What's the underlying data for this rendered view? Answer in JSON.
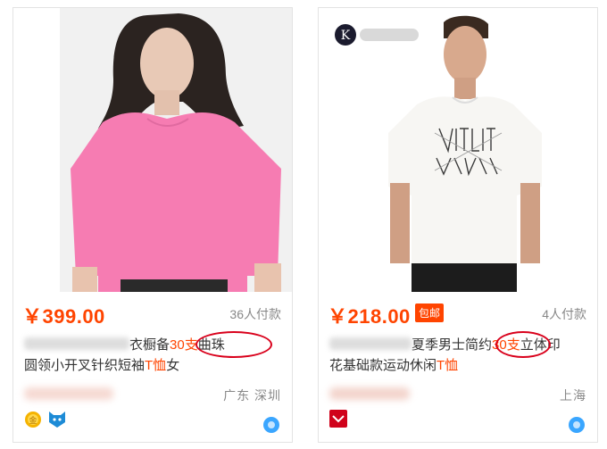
{
  "left_card": {
    "price": "￥399.00",
    "payers": "36人付款",
    "title_visible_1": "衣橱",
    "title_highlight_1": "30支",
    "title_visible_2": "曲珠",
    "title_prefix_char": "备",
    "title_line2_a": "圆领小开叉针织短袖",
    "title_line2_b": "T恤",
    "title_line2_c": "女",
    "location": "广东 深圳",
    "icons": [
      "gold-medal-icon",
      "cat-shield-icon",
      "chat-drop-icon"
    ]
  },
  "right_card": {
    "price": "￥218.00",
    "badge": "包邮",
    "payers": "4人付款",
    "title_line1_a": "夏季男士简约",
    "title_highlight_1": "30支",
    "title_line1_b": "立体印",
    "title_line2_a": "花基础款运动休闲",
    "title_line2_b": "T恤",
    "location": "上海",
    "icons": [
      "brand-logo-icon",
      "red-shop-icon",
      "chat-drop-icon"
    ]
  },
  "colors": {
    "price": "#ff4400",
    "highlight_circle": "#d9001b",
    "border": "#e3e3e3"
  }
}
